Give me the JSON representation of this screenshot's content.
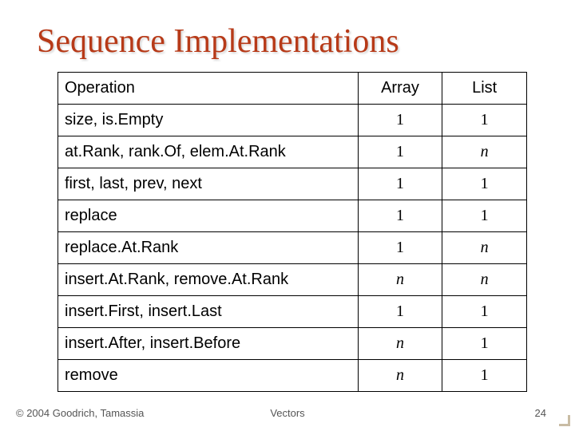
{
  "title": "Sequence Implementations",
  "chart_data": {
    "type": "table",
    "columns": [
      "Operation",
      "Array",
      "List"
    ],
    "rows": [
      {
        "op": "size, is.Empty",
        "array": {
          "v": "1",
          "i": false
        },
        "list": {
          "v": "1",
          "i": false
        }
      },
      {
        "op": "at.Rank, rank.Of, elem.At.Rank",
        "array": {
          "v": "1",
          "i": false
        },
        "list": {
          "v": "n",
          "i": true
        }
      },
      {
        "op": "first, last, prev, next",
        "array": {
          "v": "1",
          "i": false
        },
        "list": {
          "v": "1",
          "i": false
        }
      },
      {
        "op": "replace",
        "array": {
          "v": "1",
          "i": false
        },
        "list": {
          "v": "1",
          "i": false
        }
      },
      {
        "op": "replace.At.Rank",
        "array": {
          "v": "1",
          "i": false
        },
        "list": {
          "v": "n",
          "i": true
        }
      },
      {
        "op": "insert.At.Rank, remove.At.Rank",
        "array": {
          "v": "n",
          "i": true
        },
        "list": {
          "v": "n",
          "i": true
        }
      },
      {
        "op": "insert.First, insert.Last",
        "array": {
          "v": "1",
          "i": false
        },
        "list": {
          "v": "1",
          "i": false
        }
      },
      {
        "op": "insert.After, insert.Before",
        "array": {
          "v": "n",
          "i": true
        },
        "list": {
          "v": "1",
          "i": false
        }
      },
      {
        "op": "remove",
        "array": {
          "v": "n",
          "i": true
        },
        "list": {
          "v": "1",
          "i": false
        }
      }
    ]
  },
  "footer": {
    "copyright": "© 2004 Goodrich, Tamassia",
    "title": "Vectors",
    "page": "24"
  }
}
